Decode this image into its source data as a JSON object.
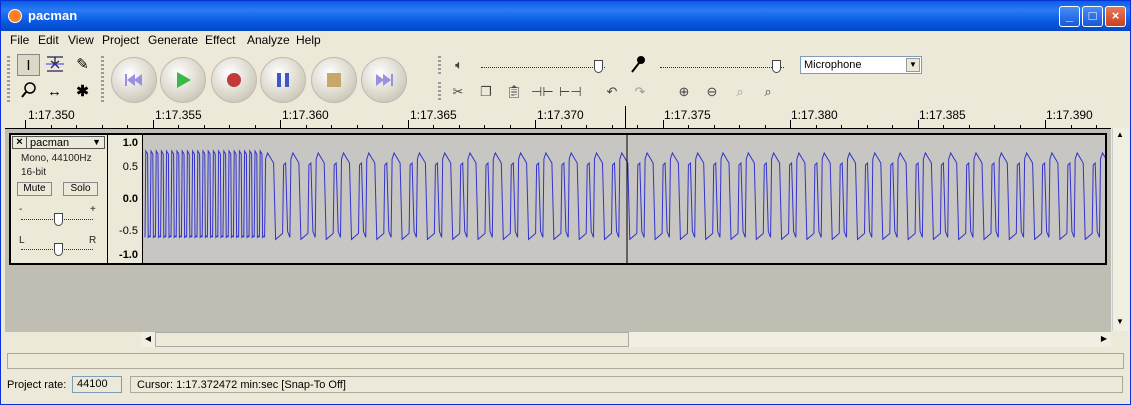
{
  "window": {
    "title": "pacman"
  },
  "menu": [
    "File",
    "Edit",
    "View",
    "Project",
    "Generate",
    "Effect",
    "Analyze",
    "Help"
  ],
  "tools": {
    "row1": [
      "selection-tool",
      "envelope-tool",
      "draw-tool"
    ],
    "row2": [
      "zoom-tool",
      "timeshift-tool",
      "multi-tool"
    ]
  },
  "transport": [
    "skip-start",
    "play",
    "record",
    "pause",
    "stop",
    "skip-end"
  ],
  "mixer": {
    "input_source": "Microphone"
  },
  "ruler": [
    "1:17.350",
    "1:17.355",
    "1:17.360",
    "1:17.365",
    "1:17.370",
    "1:17.375",
    "1:17.380",
    "1:17.385",
    "1:17.390"
  ],
  "track": {
    "name": "pacman",
    "info1": "Mono, 44100Hz",
    "info2": "16-bit",
    "mute": "Mute",
    "solo": "Solo",
    "gain_minus": "-",
    "gain_plus": "+",
    "pan_left": "L",
    "pan_right": "R",
    "scale": [
      "1.0",
      "0.5",
      "0.0",
      "-0.5",
      "-1.0"
    ]
  },
  "status": {
    "project_rate_label": "Project rate:",
    "project_rate": "44100",
    "cursor": "Cursor: 1:17.372472 min:sec   [Snap-To Off]"
  },
  "colors": {
    "titlebar": "#0a5fe0",
    "waveform": "#3333cc",
    "track_bg": "#c7c6c2"
  }
}
